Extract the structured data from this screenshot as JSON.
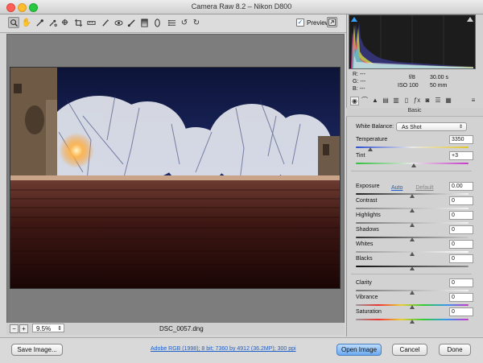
{
  "window": {
    "title": "Camera Raw 8.2  –  Nikon D800"
  },
  "toolbar": {
    "tools": [
      "zoom-tool",
      "hand-tool",
      "white-balance-tool",
      "color-sampler-tool",
      "targeted-adjustment-tool",
      "crop-tool",
      "straighten-tool",
      "spot-removal-tool",
      "red-eye-tool",
      "adjustment-brush-tool",
      "graduated-filter-tool",
      "radial-filter-tool",
      "preferences",
      "rotate-ccw",
      "rotate-cw"
    ],
    "preview_label": "Preview",
    "preview_checked": "✓"
  },
  "status": {
    "zoom": "9.5%",
    "filename": "DSC_0057.dng"
  },
  "readout": {
    "r_label": "R:",
    "g_label": "G:",
    "b_label": "B:",
    "r": "---",
    "g": "---",
    "b": "---",
    "aperture": "f/8",
    "shutter": "30.00 s",
    "iso": "ISO 100",
    "focal": "50 mm"
  },
  "panel": {
    "title": "Basic",
    "white_balance_label": "White Balance:",
    "white_balance_value": "As Shot",
    "temperature_label": "Temperature",
    "temperature": "3350",
    "tint_label": "Tint",
    "tint": "+3",
    "auto": "Auto",
    "default": "Default",
    "exposure_label": "Exposure",
    "exposure": "0.00",
    "contrast_label": "Contrast",
    "contrast": "0",
    "highlights_label": "Highlights",
    "highlights": "0",
    "shadows_label": "Shadows",
    "shadows": "0",
    "whites_label": "Whites",
    "whites": "0",
    "blacks_label": "Blacks",
    "blacks": "0",
    "clarity_label": "Clarity",
    "clarity": "0",
    "vibrance_label": "Vibrance",
    "vibrance": "0",
    "saturation_label": "Saturation",
    "saturation": "0"
  },
  "bottom": {
    "save_image": "Save Image...",
    "workflow": "Adobe RGB (1998); 8 bit; 7360 by 4912 (36.2MP); 300 ppi",
    "open_image": "Open Image",
    "cancel": "Cancel",
    "done": "Done"
  },
  "colors": {
    "accent": "#1f5fc9",
    "canvas_bg": "#7d7d7d",
    "panel_bg": "#d2d2d2"
  }
}
